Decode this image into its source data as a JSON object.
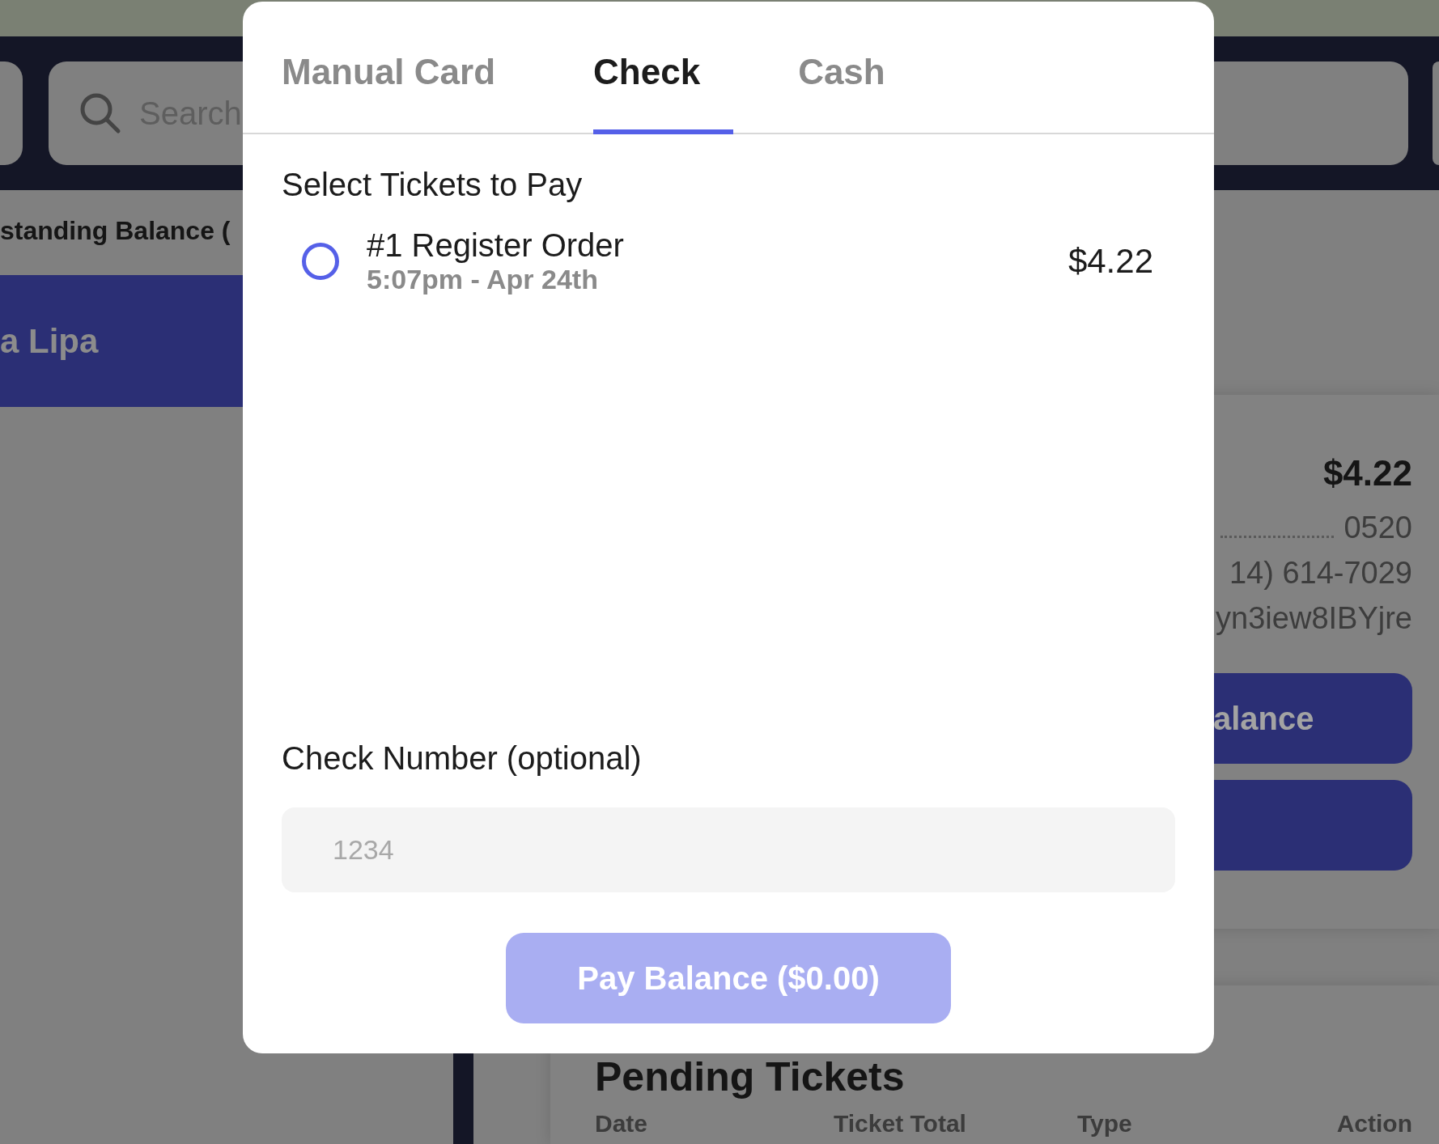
{
  "background": {
    "search": {
      "placeholder": "Search"
    },
    "balance_heading": "standing Balance (",
    "customer_row": {
      "name": "a Lipa",
      "selected": true
    },
    "summary": {
      "amount": "$4.22",
      "card_last4": "0520",
      "phone": "14) 614-7029",
      "customer_id": "yn3iew8IBYjre",
      "buttons": [
        "alance"
      ]
    },
    "pending_tickets": {
      "title": "Pending Tickets",
      "columns": [
        "Date",
        "Ticket Total",
        "Type",
        "Action"
      ]
    }
  },
  "modal": {
    "tabs": [
      {
        "label": "Manual Card",
        "selected": false
      },
      {
        "label": "Check",
        "selected": true
      },
      {
        "label": "Cash",
        "selected": false
      }
    ],
    "section_title": "Select Tickets to Pay",
    "tickets": [
      {
        "title": "#1 Register Order",
        "time": "5:07pm - Apr 24th",
        "amount": "$4.22",
        "selected": false
      }
    ],
    "check_number": {
      "label": "Check Number (optional)",
      "placeholder": "1234"
    },
    "pay_button": {
      "label": "Pay Balance ($0.00)",
      "disabled": true
    }
  }
}
